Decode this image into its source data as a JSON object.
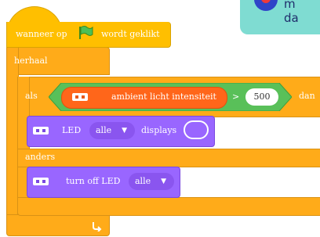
{
  "tip": {
    "line1": "m",
    "line2": "da"
  },
  "hat": {
    "prefix": "wanneer op",
    "flag_icon": "green-flag-icon",
    "suffix": "wordt geklikt"
  },
  "loop": {
    "label": "herhaal",
    "arrow_icon": "loop-arrow-icon"
  },
  "if_block": {
    "if_label": "als",
    "sensor_label": "ambient licht intensiteit",
    "operator": ">",
    "threshold": "500",
    "then_label": "dan",
    "else_label": "anders"
  },
  "led_block": {
    "label": "LED",
    "target": "alle",
    "displays_label": "displays"
  },
  "turn_off_block": {
    "label": "turn off LED",
    "target": "alle"
  },
  "colors": {
    "events": "#ffbf00",
    "control": "#ffab19",
    "device": "#9966ff",
    "sensor": "#ff661a",
    "operator": "#59c059"
  }
}
